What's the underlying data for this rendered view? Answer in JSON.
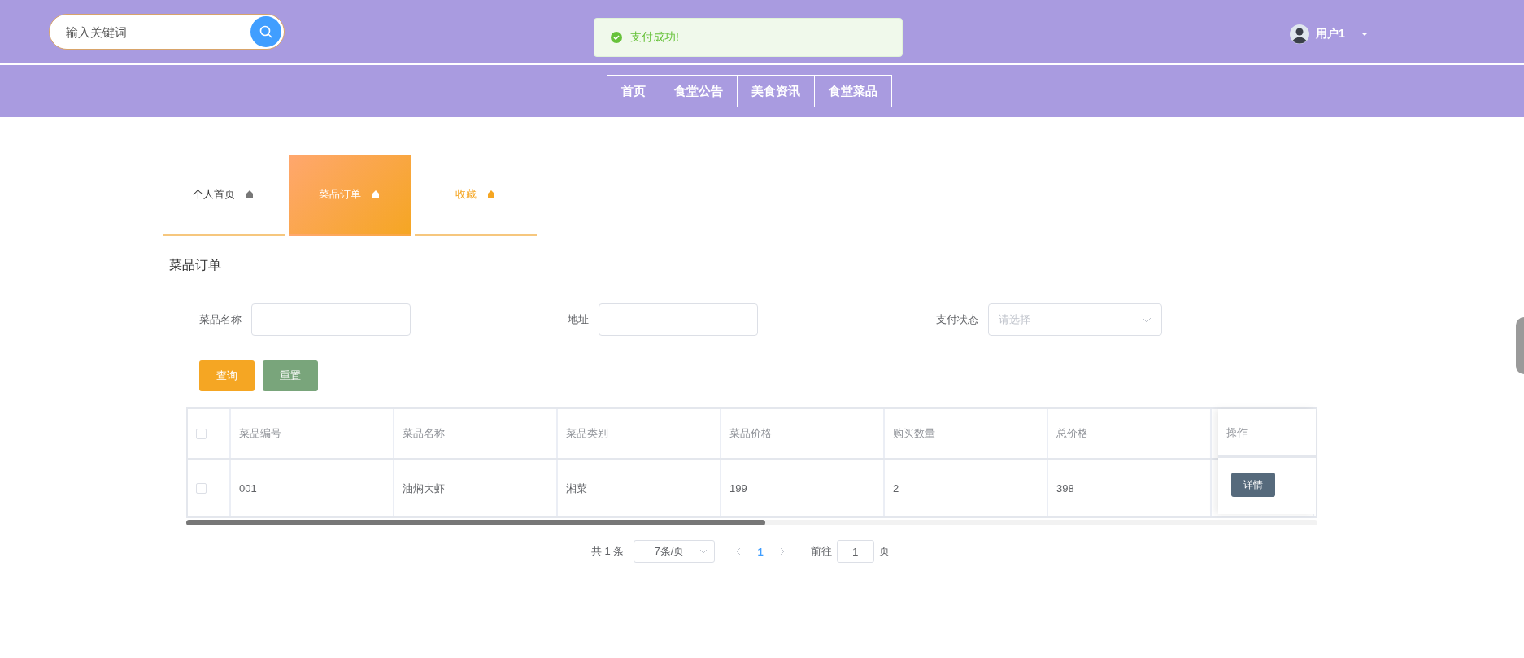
{
  "header": {
    "search": {
      "placeholder": "输入关键词"
    },
    "toast": {
      "kind": "success",
      "text": "支付成功!"
    },
    "user": {
      "name": "用户1"
    }
  },
  "nav": [
    {
      "label": "首页"
    },
    {
      "label": "食堂公告"
    },
    {
      "label": "美食资讯"
    },
    {
      "label": "食堂菜品"
    }
  ],
  "tabs": [
    {
      "label": "个人首页",
      "selected": false,
      "hovered": false
    },
    {
      "label": "菜品订单",
      "selected": true,
      "hovered": false
    },
    {
      "label": "收藏",
      "selected": false,
      "hovered": true
    }
  ],
  "page_title": "菜品订单",
  "filters": [
    {
      "label": "菜品名称",
      "kind": "input"
    },
    {
      "label": "地址",
      "kind": "input"
    },
    {
      "label": "支付状态",
      "kind": "select",
      "placeholder": "请选择"
    }
  ],
  "buttons": [
    {
      "label": "查询",
      "kind": "primary"
    },
    {
      "label": "重置",
      "kind": "secondary"
    }
  ],
  "table": {
    "columns": [
      "菜品编号",
      "菜品名称",
      "菜品类别",
      "菜品价格",
      "购买数量",
      "总价格"
    ],
    "action_column": "操作",
    "rows": [
      {
        "checked": false,
        "cells": [
          "001",
          "油焖大虾",
          "湘菜",
          "199",
          "2",
          "398"
        ],
        "action": "详情"
      }
    ],
    "header_checked": false
  },
  "pagination": {
    "total": "共 1 条",
    "page_size": "7条/页",
    "pages": [
      {
        "label": "1",
        "selected": true
      }
    ],
    "goto_label": "前往",
    "goto_value": "1",
    "goto_suffix": "页"
  }
}
